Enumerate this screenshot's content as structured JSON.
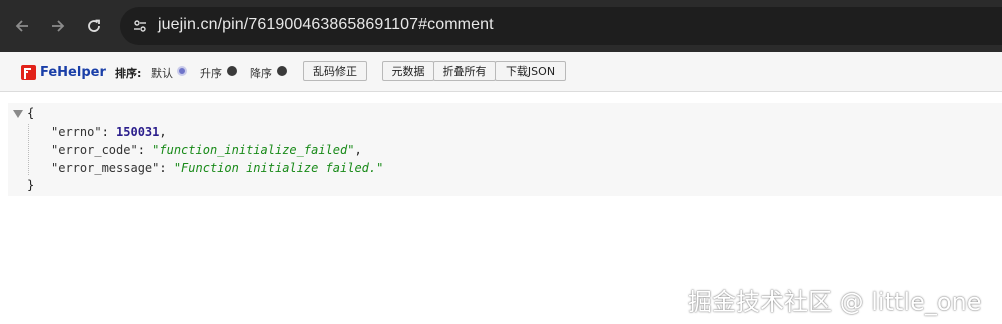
{
  "browser": {
    "url": "juejin.cn/pin/7619004638658691107#comment"
  },
  "fehelper": {
    "brand": "FeHelper",
    "sort_label": "排序:",
    "sort_default": "默认",
    "sort_asc": "升序",
    "sort_desc": "降序",
    "btn_fix_encoding": "乱码修正",
    "btn_meta": "元数据",
    "btn_collapse_all": "折叠所有",
    "btn_download": "下载JSON"
  },
  "json": {
    "open_brace": "{",
    "close_brace": "}",
    "entries": [
      {
        "key": "\"errno\"",
        "value": "150031",
        "type": "number"
      },
      {
        "key": "\"error_code\"",
        "value": "\"function_initialize_failed\"",
        "type": "string"
      },
      {
        "key": "\"error_message\"",
        "value": "\"Function initialize failed.\"",
        "type": "string"
      }
    ]
  },
  "watermark": "掘金技术社区 @ little_one"
}
